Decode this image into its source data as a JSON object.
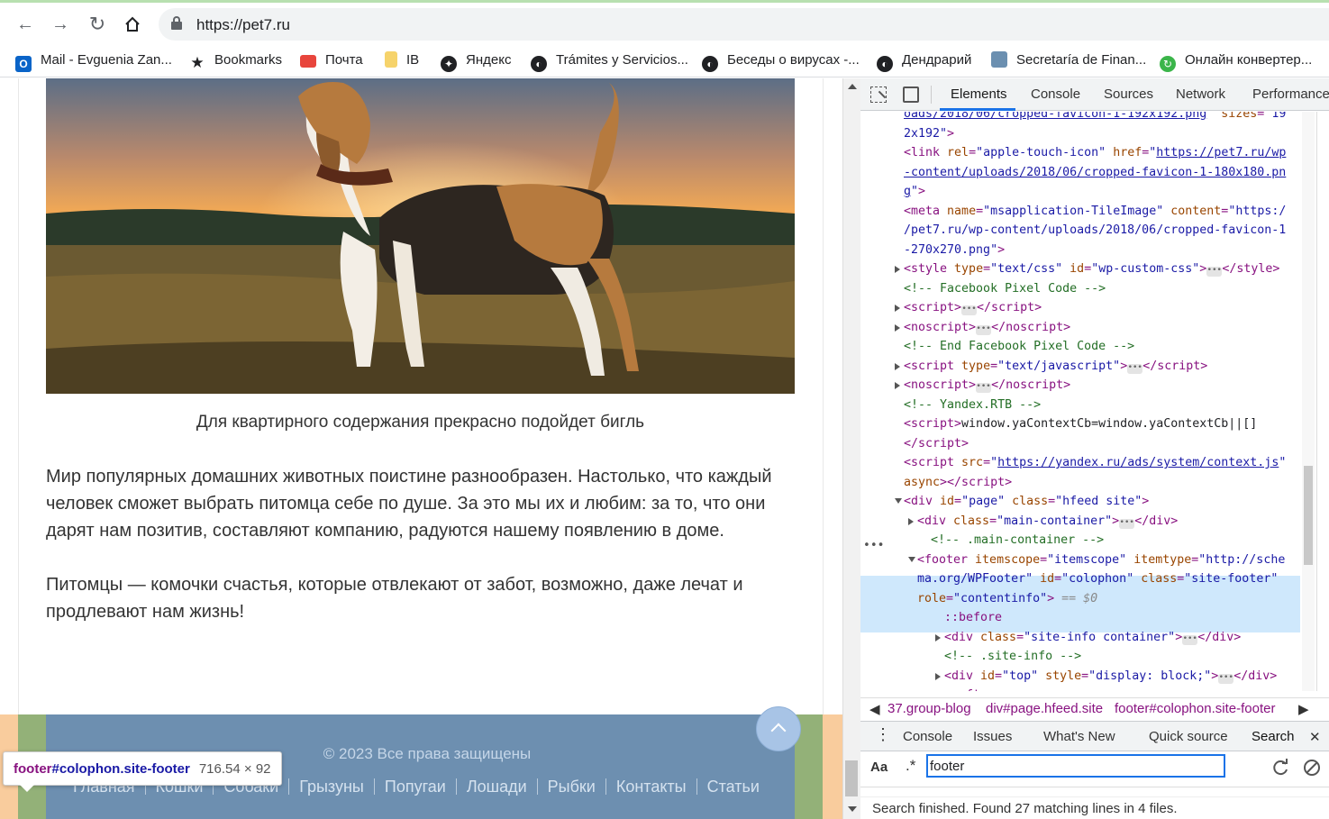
{
  "browser": {
    "url": "https://pet7.ru",
    "bookmarks": [
      {
        "label": "Mail - Evguenia Zan...",
        "icon": "outlook-icon",
        "color": "#0a64c8"
      },
      {
        "label": "Bookmarks",
        "icon": "star-icon",
        "color": "#202124"
      },
      {
        "label": "Почта",
        "icon": "mail-envelope-icon",
        "color": "#e8453c"
      },
      {
        "label": "IB",
        "icon": "folder-icon",
        "color": "#f6d36b"
      },
      {
        "label": "Яндекс",
        "icon": "compass-icon",
        "color": "#202124"
      },
      {
        "label": "Trámites y Servicios...",
        "icon": "globe-icon",
        "color": "#202124"
      },
      {
        "label": "Беседы о вирусах -...",
        "icon": "globe-icon",
        "color": "#202124"
      },
      {
        "label": "Дендрарий",
        "icon": "globe-icon",
        "color": "#202124"
      },
      {
        "label": "Secretaría de Finan...",
        "icon": "site-favicon-icon",
        "color": "#6b8fb0"
      },
      {
        "label": "Онлайн конвертер...",
        "icon": "converter-icon",
        "color": "#3bb54a"
      }
    ]
  },
  "page": {
    "caption": "Для квартирного содержания прекрасно подойдет бигль",
    "paragraph1": [
      "Мир популярных домашних животных поистине разнообразен. Настолько, что каждый",
      "человек сможет выбрать питомца себе по душе. За это мы их и любим: за то, что они",
      "дарят нам позитив, составляют компанию, радуются нашему появлению в доме."
    ],
    "paragraph2": [
      "Питомцы — комочки счастья, которые отвлекают от забот, возможно, даже лечат и",
      "продлевают нам жизнь!"
    ],
    "footer": {
      "copyright": "© 2023 Все права защищены",
      "links": [
        "Главная",
        "Кошки",
        "Собаки",
        "Грызуны",
        "Попугаи",
        "Лошади",
        "Рыбки",
        "Контакты",
        "Статьи"
      ]
    },
    "tooltip": {
      "tag": "footer",
      "selector": "#colophon.site-footer",
      "dimensions": "716.54 × 92"
    }
  },
  "devtools": {
    "tabs": [
      "Elements",
      "Console",
      "Sources",
      "Network",
      "Performance"
    ],
    "active_tab": "Elements",
    "code_lines": [
      {
        "indent": 0,
        "html": "<span class='lk'>oads/2018/06/cropped-favicon-1-192x192.png</span><span class='av'>\"</span> <span class='at'>sizes</span>=<span class='av'>\"19</span>"
      },
      {
        "indent": 0,
        "html": "<span class='av'>2x192\"</span>&gt;"
      },
      {
        "indent": 0,
        "html": "&lt;link <span class='at'>rel</span>=<span class='av'>\"apple-touch-icon\"</span> <span class='at'>href</span>=<span class='av'>\"</span><span class='lk'>https://pet7.ru/wp</span>"
      },
      {
        "indent": 0,
        "html": "<span class='lk'>-content/uploads/2018/06/cropped-favicon-1-180x180.pn</span>"
      },
      {
        "indent": 0,
        "html": "<span class='lk'>g</span><span class='av'>\"</span>&gt;"
      },
      {
        "indent": 0,
        "html": "&lt;meta <span class='at'>name</span>=<span class='av'>\"msapplication-TileImage\"</span> <span class='at'>content</span>=<span class='av'>\"https:/</span>"
      },
      {
        "indent": 0,
        "html": "<span class='av'>/pet7.ru/wp-content/uploads/2018/06/cropped-favicon-1</span>"
      },
      {
        "indent": 0,
        "html": "<span class='av'>-270x270.png\"</span>&gt;"
      },
      {
        "indent": 0,
        "tri": "right",
        "html": "&lt;style <span class='at'>type</span>=<span class='av'>\"text/css\"</span> <span class='at'>id</span>=<span class='av'>\"wp-custom-css\"</span>&gt;<span class='ell'>•••</span>&lt;/style&gt;"
      },
      {
        "indent": 0,
        "html": "<span class='cm'>&lt;!-- Facebook Pixel Code --&gt;</span>"
      },
      {
        "indent": 0,
        "tri": "right",
        "html": "&lt;script&gt;<span class='ell'>•••</span>&lt;/script&gt;"
      },
      {
        "indent": 0,
        "tri": "right",
        "html": "&lt;noscript&gt;<span class='ell'>•••</span>&lt;/noscript&gt;"
      },
      {
        "indent": 0,
        "html": "<span class='cm'>&lt;!-- End Facebook Pixel Code --&gt;</span>"
      },
      {
        "indent": 0,
        "tri": "right",
        "html": "&lt;script <span class='at'>type</span>=<span class='av'>\"text/javascript\"</span>&gt;<span class='ell'>•••</span>&lt;/script&gt;"
      },
      {
        "indent": 0,
        "tri": "right",
        "html": "&lt;noscript&gt;<span class='ell'>•••</span>&lt;/noscript&gt;"
      },
      {
        "indent": 0,
        "html": "<span class='cm'>&lt;!-- Yandex.RTB --&gt;</span>"
      },
      {
        "indent": 0,
        "html": "&lt;script&gt;<span class='tx'>window.yaContextCb=window.yaContextCb||[]</span>"
      },
      {
        "indent": 0,
        "html": "&lt;/script&gt;"
      },
      {
        "indent": 0,
        "html": "&lt;script <span class='at'>src</span>=<span class='av'>\"</span><span class='lk'>https://yandex.ru/ads/system/context.js</span><span class='av'>\"</span>"
      },
      {
        "indent": 0,
        "html": "<span class='at'>async</span>&gt;&lt;/script&gt;"
      },
      {
        "indent": -1,
        "tri": "down",
        "html": "&lt;div <span class='at'>id</span>=<span class='av'>\"page\"</span> <span class='at'>class</span>=<span class='av'>\"hfeed site\"</span>&gt;"
      },
      {
        "indent": 1,
        "tri": "right",
        "html": "&lt;div <span class='at'>class</span>=<span class='av'>\"main-container\"</span>&gt;<span class='ell'>•••</span>&lt;/div&gt;"
      },
      {
        "indent": 2,
        "html": "<span class='cm'>&lt;!-- .main-container --&gt;</span>"
      },
      {
        "indent": 1,
        "tri": "down",
        "html": "&lt;footer <span class='at'>itemscope</span>=<span class='av'>\"itemscope\"</span> <span class='at'>itemtype</span>=<span class='av'>\"http://sche</span>"
      },
      {
        "indent": 1,
        "html": "<span class='av'>ma.org/WPFooter\"</span> <span class='at'>id</span>=<span class='av'>\"colophon\"</span> <span class='at'>class</span>=<span class='av'>\"site-footer\"</span>"
      },
      {
        "indent": 1,
        "html": "<span class='at'>role</span>=<span class='av'>\"contentinfo\"</span>&gt; <span class='gr'>== <i>$0</i></span>"
      },
      {
        "indent": 3,
        "html": "<span class='ps'>::before</span>"
      },
      {
        "indent": 3,
        "tri": "right",
        "html": "&lt;div <span class='at'>class</span>=<span class='av'>\"site-info container\"</span>&gt;<span class='ell'>•••</span>&lt;/div&gt;"
      },
      {
        "indent": 3,
        "html": "<span class='cm'>&lt;!-- .site-info --&gt;</span>"
      },
      {
        "indent": 3,
        "tri": "right",
        "html": "&lt;div <span class='at'>id</span>=<span class='av'>\"top\"</span> <span class='at'>style</span>=<span class='av'>\"display: block;\"</span>&gt;<span class='ell'>•••</span>&lt;/div&gt;"
      },
      {
        "indent": 3,
        "html": "<span class='ps'>::after</span>"
      }
    ],
    "breadcrumbs": [
      "37.group-blog",
      "div#page.hfeed.site",
      "footer#colophon.site-footer"
    ],
    "drawer_tabs": [
      "Console",
      "Issues",
      "What's New",
      "Quick source",
      "Search"
    ],
    "search": {
      "case_label": "Aa",
      "regex_label": ".*",
      "query": "footer"
    },
    "status": "Search finished.  Found 27 matching lines in 4 files."
  }
}
